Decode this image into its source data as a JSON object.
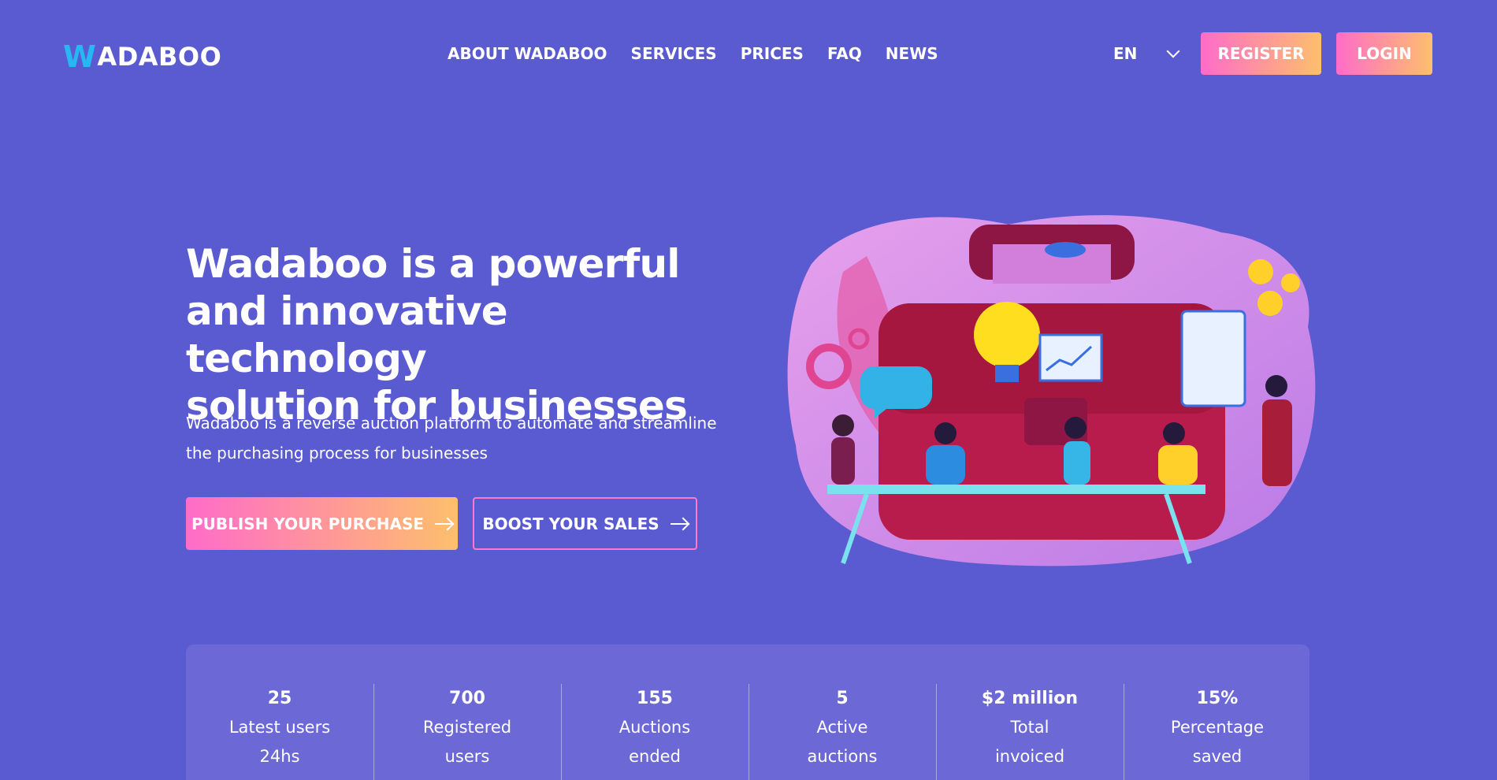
{
  "header": {
    "logo_mark": "W",
    "logo_rest": "ADABOO",
    "nav": [
      "ABOUT WADABOO",
      "SERVICES",
      "PRICES",
      "FAQ",
      "NEWS"
    ],
    "language": "EN",
    "register_label": "REGISTER",
    "login_label": "LOGIN"
  },
  "hero": {
    "headline_lines": [
      "Wadaboo is a powerful",
      "and innovative technology",
      "solution for businesses"
    ],
    "sub_lines": [
      "Wadaboo is a reverse auction platform to automate and streamline",
      "the purchasing process for businesses"
    ],
    "cta_primary": "PUBLISH YOUR PURCHASE",
    "cta_secondary": "BOOST YOUR SALES"
  },
  "stats": [
    {
      "value": "25",
      "line1": "Latest users",
      "line2": "24hs"
    },
    {
      "value": "700",
      "line1": "Registered",
      "line2": "users"
    },
    {
      "value": "155",
      "line1": "Auctions",
      "line2": "ended"
    },
    {
      "value": "5",
      "line1": "Active",
      "line2": "auctions"
    },
    {
      "value": "$2 million",
      "line1": "Total",
      "line2": "invoiced"
    },
    {
      "value": "15%",
      "line1": "Percentage",
      "line2": "saved"
    }
  ],
  "colors": {
    "background": "#5b5bd1",
    "accent_pink": "#ff6cc9",
    "accent_orange": "#fdbf6c",
    "logo_blue": "#27b7f2",
    "stats_panel": "#6c68d6"
  },
  "icons": [
    "chevron-down-icon",
    "arrow-right-icon"
  ]
}
